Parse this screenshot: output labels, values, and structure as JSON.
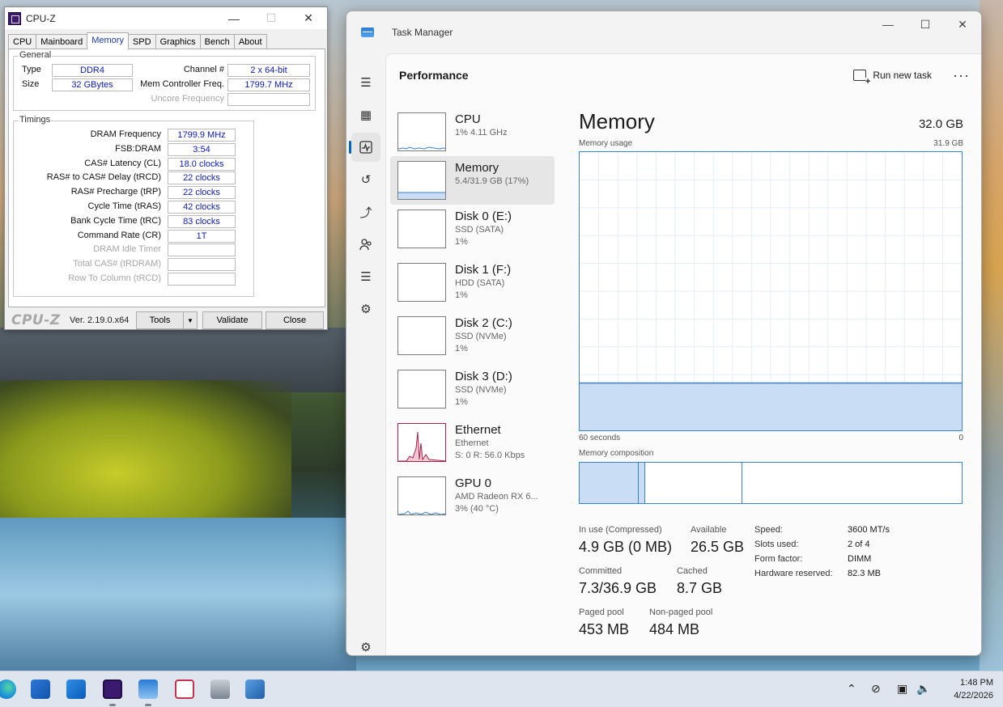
{
  "cpuz": {
    "title": "CPU-Z",
    "tabs": [
      "CPU",
      "Mainboard",
      "Memory",
      "SPD",
      "Graphics",
      "Bench",
      "About"
    ],
    "active_tab": "Memory",
    "general": {
      "group_label": "General",
      "type_label": "Type",
      "type_value": "DDR4",
      "size_label": "Size",
      "size_value": "32 GBytes",
      "channel_label": "Channel #",
      "channel_value": "2 x 64-bit",
      "mem_ctrl_label": "Mem Controller Freq.",
      "mem_ctrl_value": "1799.7 MHz",
      "uncore_label": "Uncore Frequency",
      "uncore_value": ""
    },
    "timings": {
      "group_label": "Timings",
      "rows": [
        {
          "label": "DRAM Frequency",
          "value": "1799.9 MHz",
          "dim": false
        },
        {
          "label": "FSB:DRAM",
          "value": "3:54",
          "dim": false
        },
        {
          "label": "CAS# Latency (CL)",
          "value": "18.0 clocks",
          "dim": false
        },
        {
          "label": "RAS# to CAS# Delay (tRCD)",
          "value": "22 clocks",
          "dim": false
        },
        {
          "label": "RAS# Precharge (tRP)",
          "value": "22 clocks",
          "dim": false
        },
        {
          "label": "Cycle Time (tRAS)",
          "value": "42 clocks",
          "dim": false
        },
        {
          "label": "Bank Cycle Time (tRC)",
          "value": "83 clocks",
          "dim": false
        },
        {
          "label": "Command Rate (CR)",
          "value": "1T",
          "dim": false
        },
        {
          "label": "DRAM Idle Timer",
          "value": "",
          "dim": true
        },
        {
          "label": "Total CAS# (tRDRAM)",
          "value": "",
          "dim": true
        },
        {
          "label": "Row To Column (tRCD)",
          "value": "",
          "dim": true
        }
      ]
    },
    "bottom": {
      "logo": "CPU-Z",
      "version": "Ver. 2.19.0.x64",
      "tools_label": "Tools",
      "validate_label": "Validate",
      "close_label": "Close"
    }
  },
  "taskmanager": {
    "title": "Task Manager",
    "page_title": "Performance",
    "run_new_task": "Run new task",
    "more": "···",
    "devices": [
      {
        "name": "CPU",
        "sub1": "1% 4.11 GHz",
        "sub2": "",
        "selected": false
      },
      {
        "name": "Memory",
        "sub1": "5.4/31.9 GB (17%)",
        "sub2": "",
        "selected": true
      },
      {
        "name": "Disk 0 (E:)",
        "sub1": "SSD (SATA)",
        "sub2": "1%",
        "selected": false
      },
      {
        "name": "Disk 1 (F:)",
        "sub1": "HDD (SATA)",
        "sub2": "1%",
        "selected": false
      },
      {
        "name": "Disk 2 (C:)",
        "sub1": "SSD (NVMe)",
        "sub2": "1%",
        "selected": false
      },
      {
        "name": "Disk 3 (D:)",
        "sub1": "SSD (NVMe)",
        "sub2": "1%",
        "selected": false
      },
      {
        "name": "Ethernet",
        "sub1": "Ethernet",
        "sub2": "S: 0 R: 56.0 Kbps",
        "selected": false
      },
      {
        "name": "GPU 0",
        "sub1": "AMD Radeon RX 6...",
        "sub2": "3% (40 °C)",
        "selected": false
      }
    ],
    "detail": {
      "title": "Memory",
      "total": "32.0 GB",
      "usage_label": "Memory usage",
      "usage_max": "31.9 GB",
      "time_left": "60 seconds",
      "time_right": "0",
      "usage_fraction": 0.17,
      "composition_label": "Memory composition",
      "stats": {
        "in_use_label": "In use (Compressed)",
        "in_use_value": "4.9 GB (0 MB)",
        "available_label": "Available",
        "available_value": "26.5 GB",
        "committed_label": "Committed",
        "committed_value": "7.3/36.9 GB",
        "cached_label": "Cached",
        "cached_value": "8.7 GB",
        "paged_label": "Paged pool",
        "paged_value": "453 MB",
        "nonpaged_label": "Non-paged pool",
        "nonpaged_value": "484 MB"
      },
      "specs": [
        {
          "label": "Speed:",
          "value": "3600 MT/s"
        },
        {
          "label": "Slots used:",
          "value": "2 of 4"
        },
        {
          "label": "Form factor:",
          "value": "DIMM"
        },
        {
          "label": "Hardware reserved:",
          "value": "82.3 MB"
        }
      ]
    },
    "colors": {
      "accent": "#0067c0",
      "memory_fill": "#c9ddf5",
      "memory_line": "#3b83c9",
      "ethernet_line": "#a8234a",
      "ethernet_fill": "#f2c9d4"
    }
  },
  "taskbar": {
    "time": "1:48 PM",
    "date": "4/22/2026",
    "pinned": [
      "edge-icon",
      "store-icon",
      "outlook-icon",
      "cpuz-icon",
      "taskmanager-icon",
      "snipping-tool-icon",
      "device-manager-icon",
      "remote-desktop-icon"
    ]
  }
}
